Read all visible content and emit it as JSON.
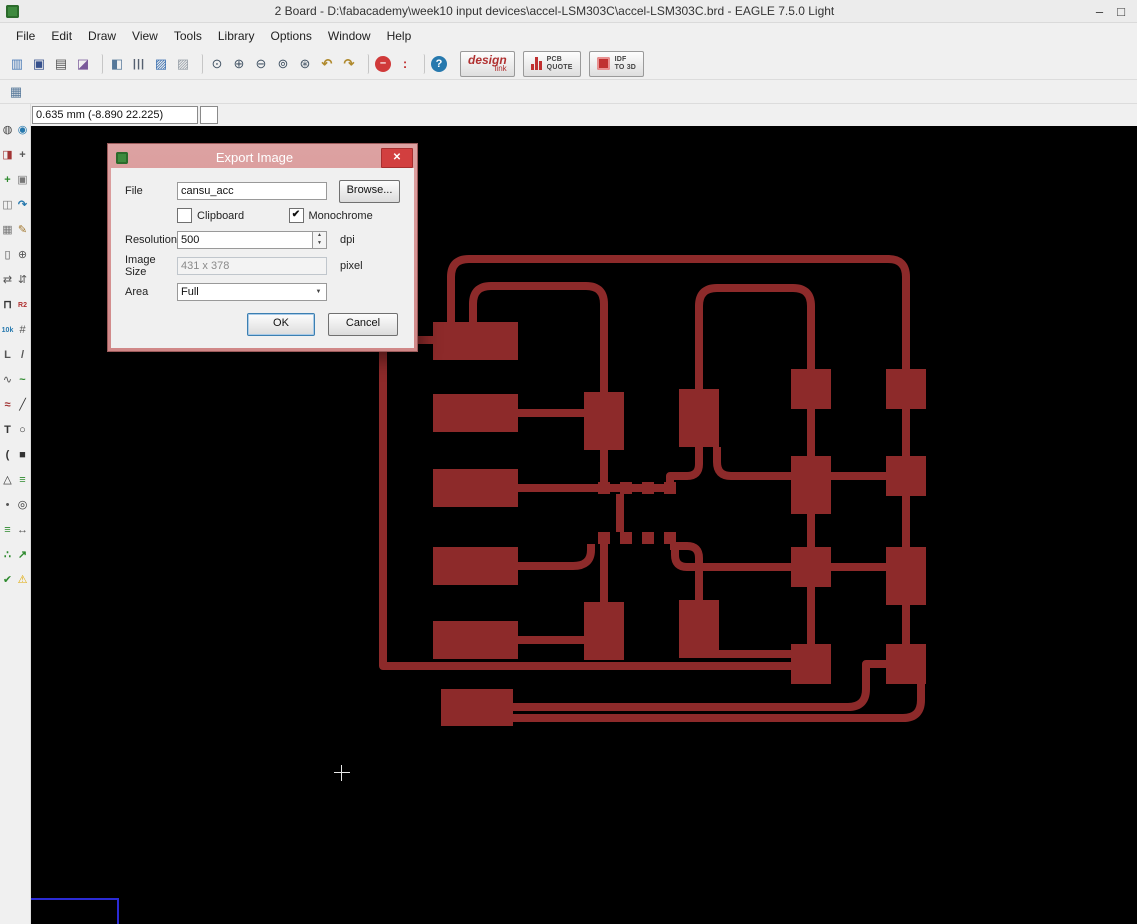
{
  "window": {
    "title": "2 Board - D:\\fabacademy\\week10 input devices\\accel-LSM303C\\accel-LSM303C.brd - EAGLE 7.5.0 Light",
    "minimize": "–",
    "maximize": "□"
  },
  "menu": {
    "items": [
      "File",
      "Edit",
      "Draw",
      "View",
      "Tools",
      "Library",
      "Options",
      "Window",
      "Help"
    ]
  },
  "toolbar": {
    "icons": [
      {
        "n": "open-icon",
        "g": "▥",
        "s": "color:#4a7ab5"
      },
      {
        "n": "save-icon",
        "g": "▣",
        "s": "color:#35508c"
      },
      {
        "n": "print-icon",
        "g": "▤",
        "s": "color:#555555"
      },
      {
        "n": "export-image-icon",
        "g": "◪",
        "s": "color:#7a5a9a"
      },
      {
        "n": "separator",
        "g": "",
        "s": "width:5px;height:20px;border-right:1px solid #c6c6c6;margin:0 3px",
        "i": "false"
      },
      {
        "n": "load-layers-icon",
        "g": "◧",
        "s": "color:#557799"
      },
      {
        "n": "layer-bars-icon",
        "g": "|||",
        "s": "color:#556070;font-size:11px;font-weight:bold;letter-spacing:1px"
      },
      {
        "n": "display-layers-icon",
        "g": "▨",
        "s": "color:#3a6fb0"
      },
      {
        "n": "sheet-preview-icon",
        "g": "▨",
        "s": "color:#98a0a8"
      },
      {
        "n": "separator",
        "g": "",
        "s": "width:5px;height:20px;border-right:1px solid #c6c6c6;margin:0 3px",
        "i": "false"
      },
      {
        "n": "zoom-fit-icon",
        "g": "⊙",
        "s": "color:#445566"
      },
      {
        "n": "zoom-in-icon",
        "g": "⊕",
        "s": "color:#445566"
      },
      {
        "n": "zoom-out-icon",
        "g": "⊖",
        "s": "color:#445566"
      },
      {
        "n": "zoom-select-icon",
        "g": "⊚",
        "s": "color:#445566"
      },
      {
        "n": "zoom-redraw-icon",
        "g": "⊛",
        "s": "color:#445566"
      },
      {
        "n": "undo-icon",
        "g": "↶",
        "s": "color:#b08a2e;font-weight:bold"
      },
      {
        "n": "redo-icon",
        "g": "↷",
        "s": "color:#b08a2e;font-weight:bold"
      },
      {
        "n": "separator",
        "g": "",
        "s": "width:5px;height:20px;border-right:1px solid #c6c6c6;margin:0 3px",
        "i": "false"
      },
      {
        "n": "stop-icon",
        "g": "–",
        "s": "background:#d03a3a;color:#ffffff;border-radius:50%;font-weight:bold;width:16px;height:16px;line-height:15px;margin:3px;font-size:11px"
      },
      {
        "n": "traffic-light-icon",
        "g": ":",
        "s": "color:#c03030;font-weight:bold"
      },
      {
        "n": "separator",
        "g": "",
        "s": "width:5px;height:20px;border-right:1px solid #c6c6c6;margin:0 3px",
        "i": "false"
      },
      {
        "n": "help-icon",
        "g": "?",
        "s": "background:#2779ae;color:#ffffff;border-radius:50%;font-weight:bold;width:16px;height:16px;line-height:16px;margin:3px;font-size:11px"
      }
    ],
    "design_link": {
      "line1": "design",
      "line2": "link"
    },
    "pcb_quote": {
      "line1": "PCB",
      "line2": "QUOTE"
    },
    "idf": {
      "line1": "IDF",
      "line2": "TO 3D"
    }
  },
  "toolbar2": {
    "grid_glyph": "▦"
  },
  "coordbar": {
    "value": "0.635 mm (-8.890 22.225)"
  },
  "sidebar": {
    "icons": [
      {
        "n": "info-icon",
        "g": "◍",
        "s": "color:#444444"
      },
      {
        "n": "show-icon",
        "g": "◉",
        "s": "color:#2779ae"
      },
      {
        "n": "display-icon",
        "g": "◨",
        "s": "color:#a23535"
      },
      {
        "n": "mark-icon",
        "g": "+",
        "s": "color:#555555;font-weight:bold"
      },
      {
        "n": "move-icon",
        "g": "+",
        "s": "color:#2e8a2e;font-weight:bold"
      },
      {
        "n": "copy-icon",
        "g": "▣",
        "s": "color:#777777"
      },
      {
        "n": "mirror-icon",
        "g": "◫",
        "s": "color:#777777"
      },
      {
        "n": "rotate-icon",
        "g": "↷",
        "s": "color:#2779ae;font-weight:bold"
      },
      {
        "n": "group-icon",
        "g": "▦",
        "s": "color:#777777"
      },
      {
        "n": "change-icon",
        "g": "✎",
        "s": "color:#a0752b"
      },
      {
        "n": "delete-icon",
        "g": "▯",
        "s": "color:#555555"
      },
      {
        "n": "add-icon",
        "g": "⊕",
        "s": "color:#555555"
      },
      {
        "n": "pinswap-icon",
        "g": "⇄",
        "s": "color:#555555"
      },
      {
        "n": "replace-icon",
        "g": "⇵",
        "s": "color:#555555"
      },
      {
        "n": "lock-icon",
        "g": "⊓",
        "s": "color:#333333;font-weight:bold"
      },
      {
        "n": "name-icon",
        "g": "R2",
        "s": "color:#b03030;font-size:7px;font-weight:bold"
      },
      {
        "n": "value-icon",
        "g": "10k",
        "s": "color:#2779ae;font-size:7px;font-weight:bold"
      },
      {
        "n": "smash-icon",
        "g": "#",
        "s": "color:#555555"
      },
      {
        "n": "miter-icon",
        "g": "L",
        "s": "color:#555555;font-weight:bold"
      },
      {
        "n": "split-icon",
        "g": "/",
        "s": "color:#555555;font-weight:bold"
      },
      {
        "n": "optimize-icon",
        "g": "∿",
        "s": "color:#555555"
      },
      {
        "n": "route-icon",
        "g": "~",
        "s": "color:#2e8a2e;font-weight:bold"
      },
      {
        "n": "ripup-icon",
        "g": "≈",
        "s": "color:#a23535;font-weight:bold"
      },
      {
        "n": "wire-icon",
        "g": "╱",
        "s": "color:#333333"
      },
      {
        "n": "text-icon",
        "g": "T",
        "s": "color:#333333;font-weight:bold"
      },
      {
        "n": "circle-icon",
        "g": "○",
        "s": "color:#333333"
      },
      {
        "n": "arc-icon",
        "g": "(",
        "s": "color:#333333;font-weight:bold"
      },
      {
        "n": "rect-icon",
        "g": "■",
        "s": "color:#333333"
      },
      {
        "n": "polygon-icon",
        "g": "△",
        "s": "color:#333333"
      },
      {
        "n": "via-icon",
        "g": "≡",
        "s": "color:#2e8a2e;font-weight:bold"
      },
      {
        "n": "signal-icon",
        "g": "•",
        "s": "color:#555555"
      },
      {
        "n": "hole-icon",
        "g": "◎",
        "s": "color:#333333"
      },
      {
        "n": "pad-icon",
        "g": "≡",
        "s": "color:#2e8a2e"
      },
      {
        "n": "dimension-icon",
        "g": "↔",
        "s": "color:#555555"
      },
      {
        "n": "ratsnest-icon",
        "g": "∴",
        "s": "color:#2e8a2e;font-weight:bold"
      },
      {
        "n": "auto-route-icon",
        "g": "↗",
        "s": "color:#2e8a2e;font-weight:bold"
      },
      {
        "n": "drc-icon",
        "g": "✔",
        "s": "color:#2e8a2e"
      },
      {
        "n": "errors-icon",
        "g": "⚠",
        "s": "color:#e0a800"
      }
    ]
  },
  "dialog": {
    "title": "Export Image",
    "close_glyph": "✕",
    "file_label": "File",
    "file_value": "cansu_acc",
    "browse_label": "Browse...",
    "clipboard_label": "Clipboard",
    "monochrome_label": "Monochrome",
    "check_glyph": "✔",
    "resolution_label": "Resolution",
    "resolution_value": "500",
    "dpi_label": "dpi",
    "spin_up": "▲",
    "spin_down": "▼",
    "image_size_label": "Image Size",
    "image_size_value": "431 x 378",
    "pixel_label": "pixel",
    "area_label": "Area",
    "area_value": "Full",
    "dropdown_glyph": "▼",
    "ok_label": "OK",
    "cancel_label": "Cancel"
  },
  "colors": {
    "pcb_trace": "#8d2a2a",
    "canvas_bg": "#000000",
    "dialog_frame": "#d08888",
    "close_button": "#d23f3f",
    "board_outline": "#2b2bd5"
  }
}
